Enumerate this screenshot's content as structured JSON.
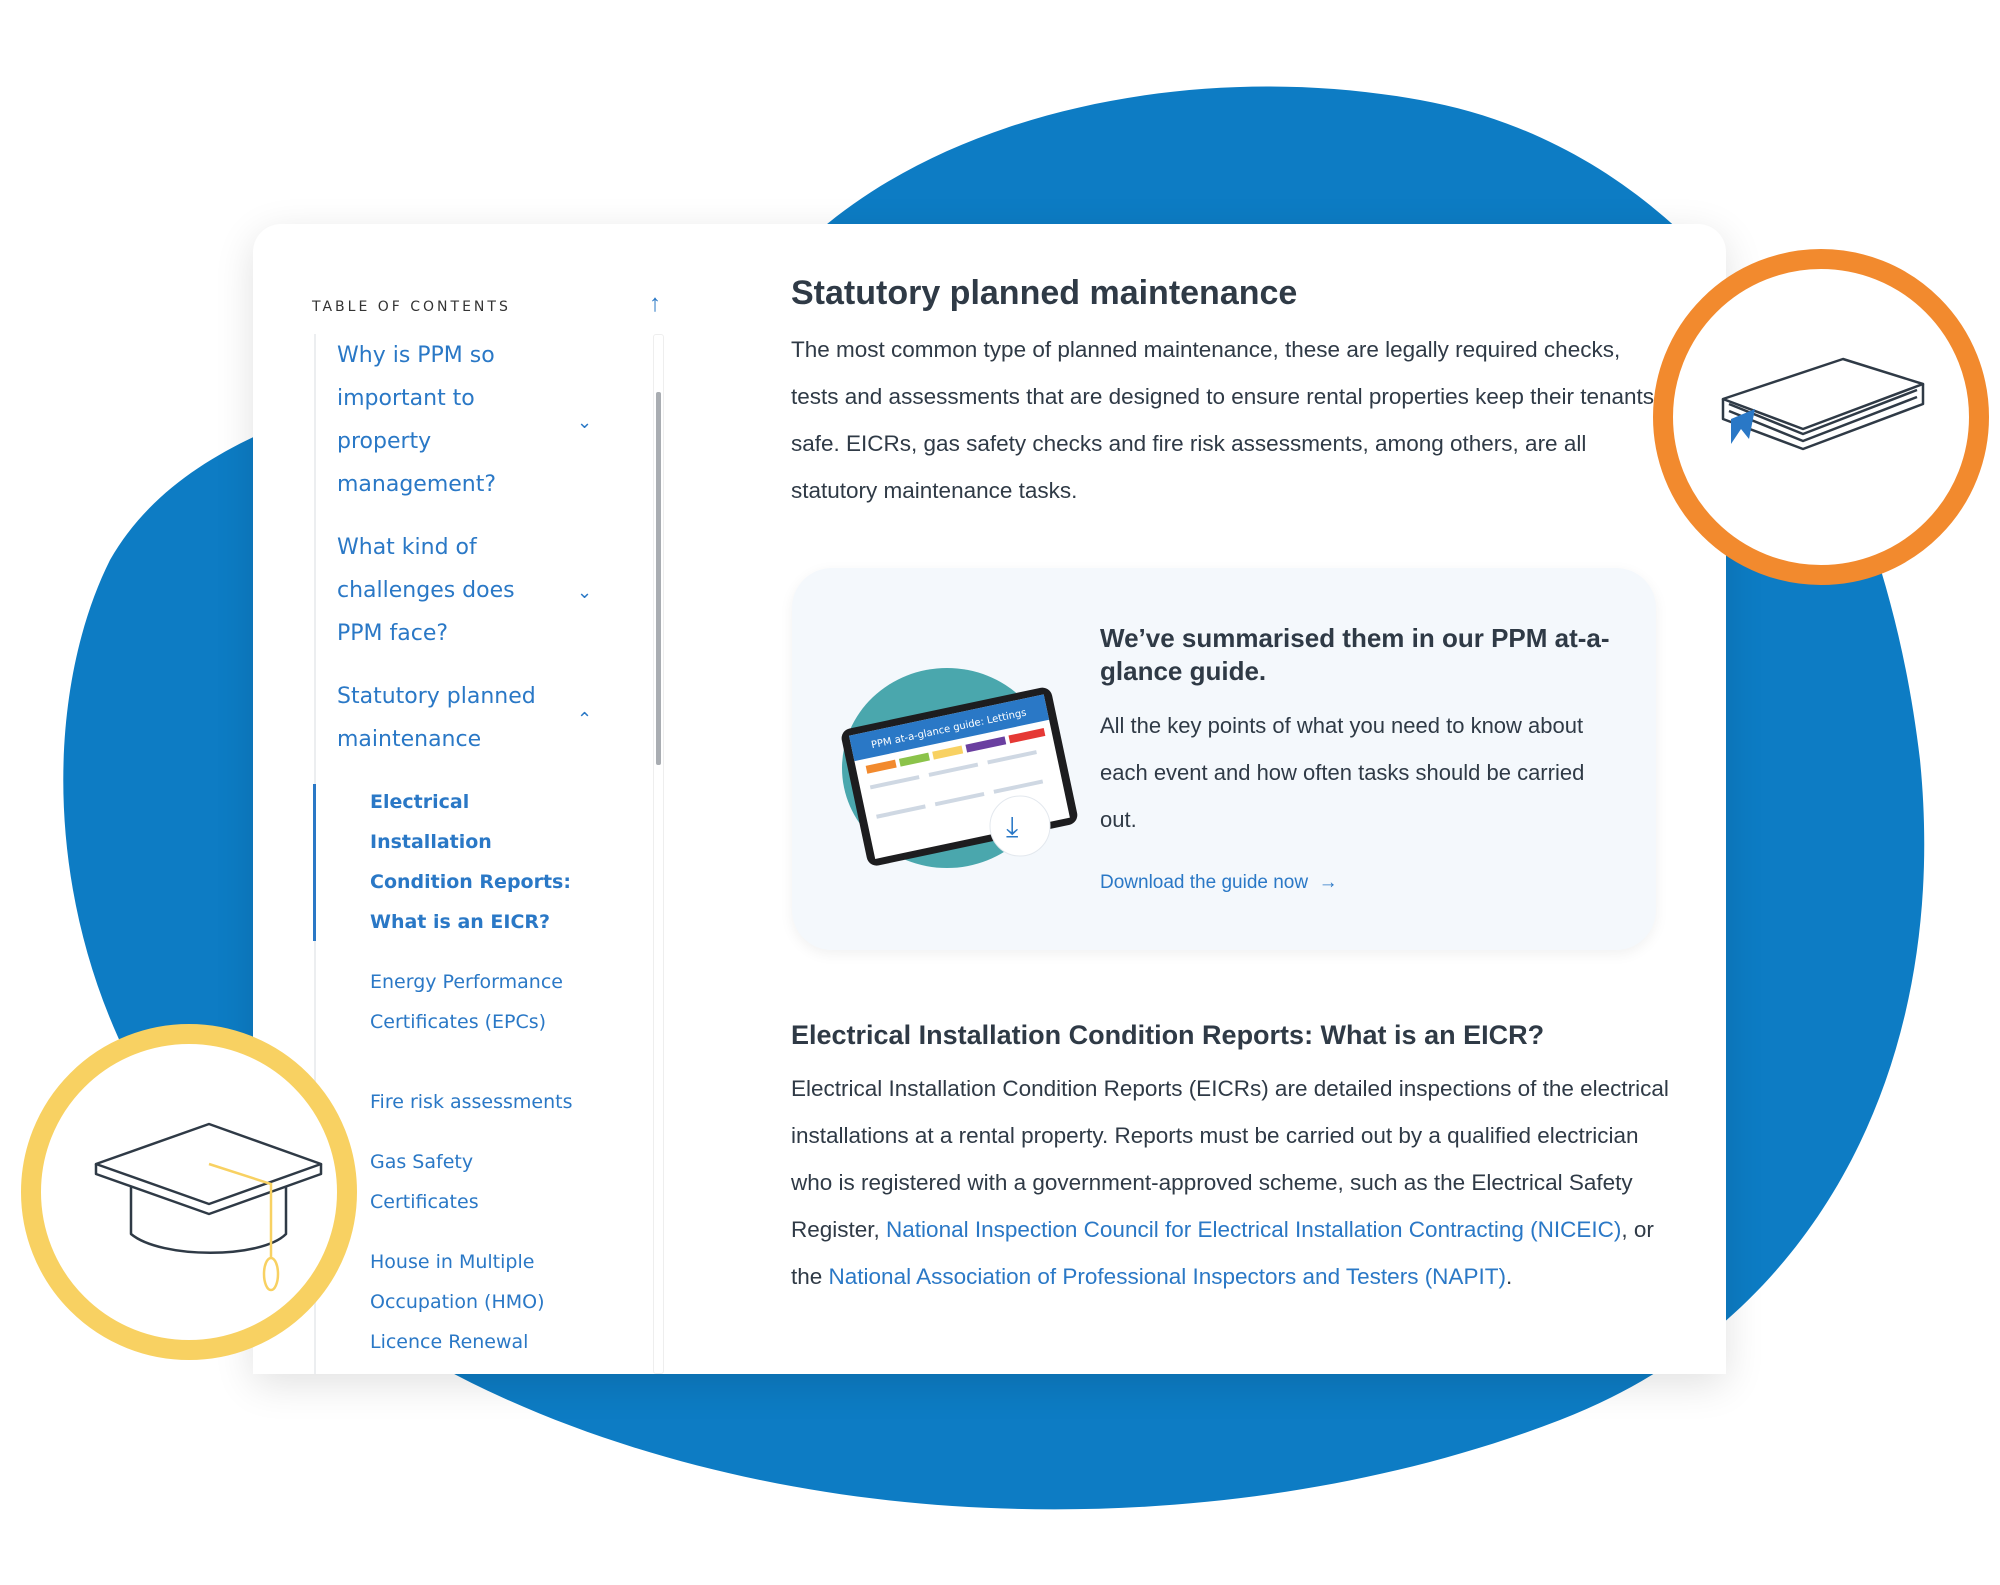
{
  "colors": {
    "accent": "#2a78c6",
    "blob": "#0d7cc4",
    "orange": "#f28a2e",
    "yellow": "#f8d162",
    "text": "#2f3a46"
  },
  "toc": {
    "label": "TABLE OF CONTENTS",
    "items": [
      {
        "label": "Why is PPM so important to property management?",
        "state": "collapsed"
      },
      {
        "label": "What kind of challenges does PPM face?",
        "state": "collapsed"
      },
      {
        "label": "Statutory planned maintenance",
        "state": "expanded"
      }
    ],
    "subitems": [
      {
        "label": "Electrical Installation Condition Reports: What is an EICR?",
        "active": true
      },
      {
        "label": "Energy Performance Certificates (EPCs)"
      },
      {
        "label": "Fire risk assessments"
      },
      {
        "label": "Gas Safety Certificates"
      },
      {
        "label": "House in Multiple Occupation (HMO) Licence Renewal"
      }
    ]
  },
  "main": {
    "title": "Statutory planned maintenance",
    "intro": "The most common type of planned maintenance, these are legally required checks, tests and assessments that are designed to ensure rental properties keep their tenants safe. EICRs, gas safety checks and fire risk assessments, among others, are all statutory maintenance tasks.",
    "promo": {
      "heading": "We’ve summarised them in our PPM at-a-glance guide.",
      "body": "All the key points of what you need to know about each event and how often tasks should be carried out.",
      "link": "Download the guide now",
      "image_title": "PPM at-a-glance guide: Lettings"
    },
    "section_title": "Electrical Installation Condition Reports: What is an EICR?",
    "section_text_1": "Electrical Installation Condition Reports (EICRs) are detailed inspections of the electrical installations at a rental property. Reports must be carried out by a qualified electrician who is registered with a government-approved scheme, such as the Electrical Safety Register, ",
    "link_1": "National Inspection Council for Electrical Installation Contracting (NICEIC)",
    "section_text_2": ", or the ",
    "link_2": "National Association of Professional Inspectors and Testers (NAPIT)",
    "section_text_3": "."
  },
  "icons": {
    "book": "book-icon",
    "cap": "graduation-cap-icon",
    "download": "download-icon",
    "up": "arrow-up-icon"
  }
}
